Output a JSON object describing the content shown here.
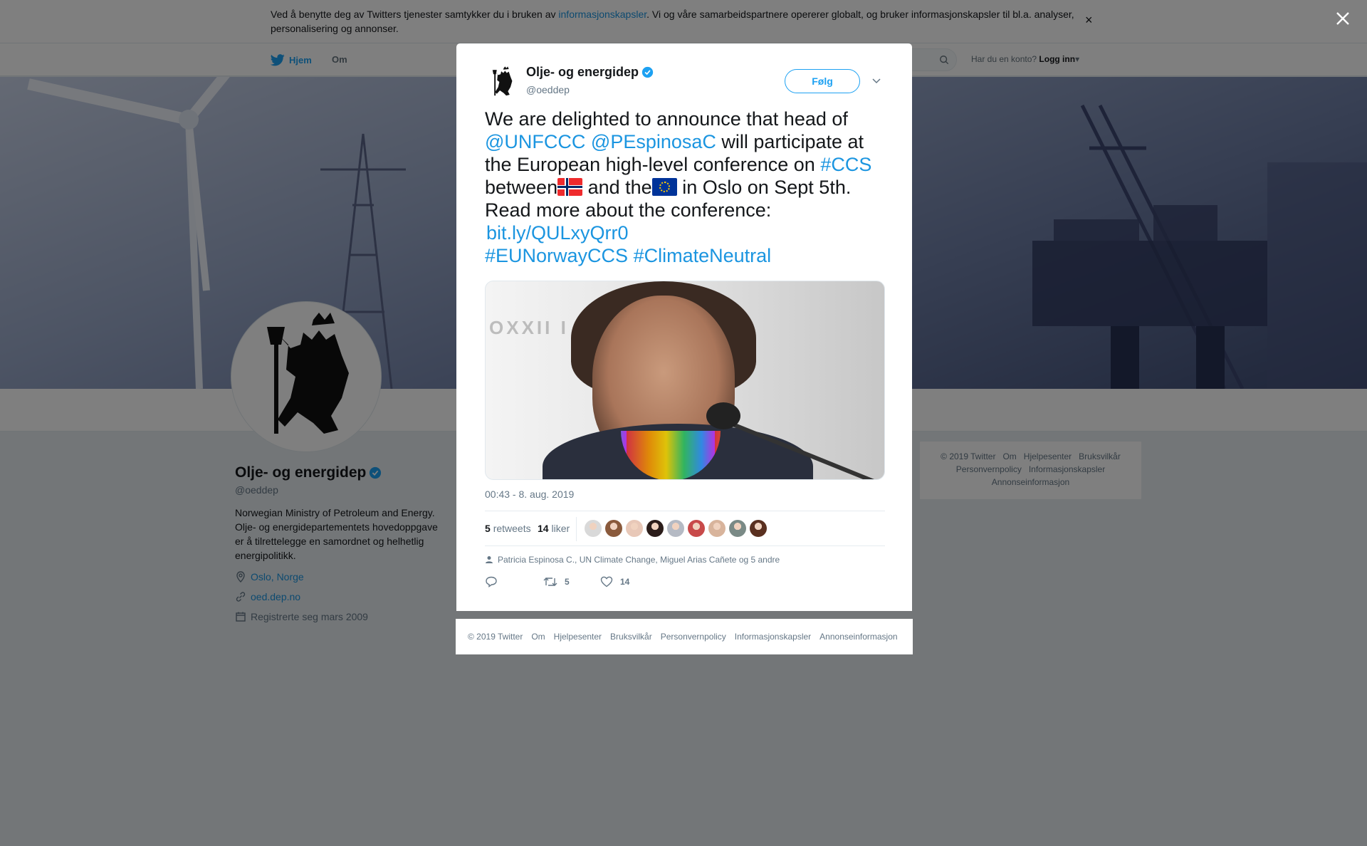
{
  "cookie_banner": {
    "text_before": "Ved å benytte deg av Twitters tjenester samtykker du i bruken av ",
    "link": "informasjonskapsler",
    "text_after": ". Vi og våre samarbeidspartnere opererer globalt, og bruker informasjonskapsler til bl.a. analyser, personalisering og annonser.",
    "close": "×"
  },
  "topnav": {
    "home": "Hjem",
    "about": "Om",
    "login_prompt": "Har du en konto?",
    "login": "Logg inn"
  },
  "profile": {
    "name": "Olje- og energidep",
    "handle": "@oeddep",
    "bio": "Norwegian Ministry of Petroleum and Energy. Olje- og energidepartementets hovedoppgave er å tilrettelegge en samordnet og helhetlig energipolitikk.",
    "location": "Oslo, Norge",
    "website": "oed.dep.no",
    "joined": "Registrerte seg mars 2009"
  },
  "side_footer": {
    "line1": "© 2019 Twitter   Om   Hjelpesenter   Bruksvilkår",
    "line2": "Personvernpolicy   Informasjonskapsler",
    "line3": "Annonseinformasjon"
  },
  "tweet": {
    "author_name": "Olje- og energidep",
    "author_handle": "@oeddep",
    "follow": "Følg",
    "text": {
      "p1": "We are delighted to announce that head of ",
      "m1": "@UNFCCC",
      "m2": "@PEspinosaC",
      "p2": " will participate at the European high-level conference on ",
      "h1": "#CCS",
      "p3": "between",
      "p4": " and the",
      "p5": " in Oslo on Sept 5th. Read more about the conference:",
      "link": "bit.ly/QULxyQrr0",
      "h2": "#EUNorwayCCS",
      "h3": "#ClimateNeutral"
    },
    "photo_text": "OXXII I ...",
    "timestamp": "00:43 - 8. aug. 2019",
    "retweets_count": "5",
    "retweets_label": "retweets",
    "likes_count": "14",
    "likes_label": "liker",
    "reply_context": "Patricia Espinosa C., UN Climate Change, Miguel Arias Cañete og 5 andre",
    "action_retweet_count": "5",
    "action_like_count": "14"
  },
  "liker_colors": [
    "#d9d9d9",
    "#8a5a3c",
    "#e8c8b8",
    "#2b1d1a",
    "#b5bac4",
    "#c84a4a",
    "#d8b49c",
    "#7a8a86",
    "#5a3020"
  ],
  "modal_footer": {
    "copyright": "© 2019 Twitter",
    "about": "Om",
    "help": "Hjelpesenter",
    "terms": "Bruksvilkår",
    "privacy": "Personvernpolicy",
    "cookies": "Informasjonskapsler",
    "ads": "Annonseinformasjon"
  },
  "colors": {
    "twitter_blue": "#1da1f2",
    "link_blue": "#1b95e0",
    "overlay": "rgba(0,0,0,0.5)"
  }
}
